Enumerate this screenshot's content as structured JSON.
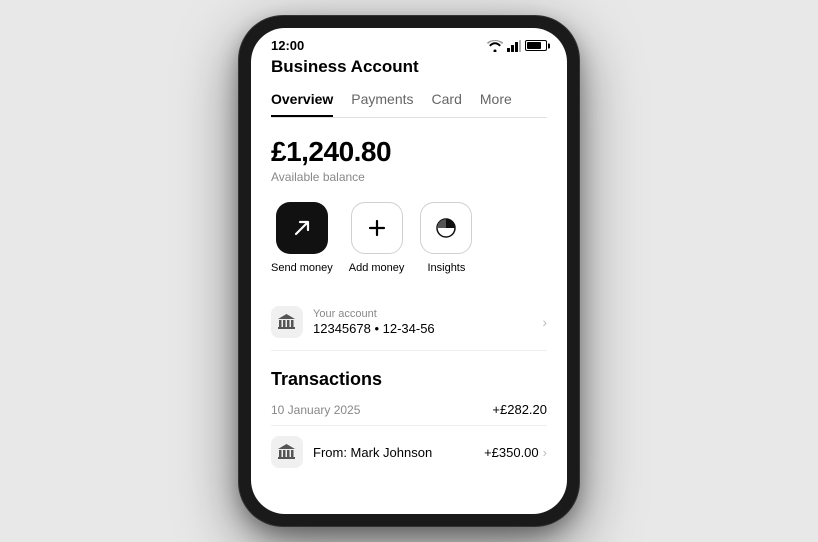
{
  "statusBar": {
    "time": "12:00"
  },
  "header": {
    "title": "Business Account"
  },
  "tabs": [
    {
      "label": "Overview",
      "active": true
    },
    {
      "label": "Payments",
      "active": false
    },
    {
      "label": "Card",
      "active": false
    },
    {
      "label": "More",
      "active": false
    }
  ],
  "balance": {
    "amount": "£1,240.80",
    "label": "Available balance"
  },
  "actions": [
    {
      "key": "send-money",
      "label": "Send money",
      "style": "dark"
    },
    {
      "key": "add-money",
      "label": "Add money",
      "style": "light"
    },
    {
      "key": "insights",
      "label": "Insights",
      "style": "light"
    }
  ],
  "accountRow": {
    "label": "Your account",
    "number": "12345678 • 12-34-56"
  },
  "transactions": {
    "title": "Transactions",
    "dateRow": {
      "date": "10 January 2025",
      "amount": "+£282.20"
    },
    "items": [
      {
        "name": "From: Mark Johnson",
        "amount": "+£350.00"
      }
    ]
  }
}
